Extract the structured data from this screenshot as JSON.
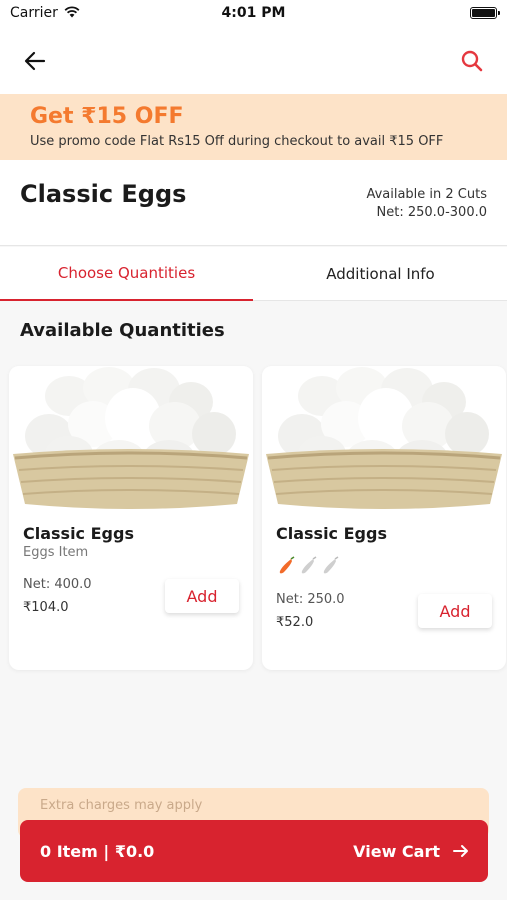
{
  "status_bar": {
    "carrier": "Carrier",
    "time": "4:01 PM"
  },
  "nav": {
    "back_icon": "arrow-left-icon",
    "search_icon": "search-icon"
  },
  "promo": {
    "title": "Get ₹15 OFF",
    "subtitle": "Use promo code Flat Rs15 Off  during checkout to avail ₹15 OFF"
  },
  "product": {
    "name": "Classic Eggs",
    "cuts": "Available in 2 Cuts",
    "net": "Net: 250.0-300.0"
  },
  "tabs": [
    {
      "label": "Choose Quantities",
      "active": true
    },
    {
      "label": "Additional Info",
      "active": false
    }
  ],
  "section_title": "Available Quantities",
  "cards": [
    {
      "name": "Classic Eggs",
      "type": "Eggs Item",
      "net": "Net: 400.0",
      "price": "₹104.0",
      "add_label": "Add"
    },
    {
      "name": "Classic Eggs",
      "spice_level": 1,
      "spice_max": 3,
      "net": "Net: 250.0",
      "price": "₹52.0",
      "add_label": "Add"
    }
  ],
  "extra_charges": "Extra charges may apply",
  "cart": {
    "summary": "0 Item | ₹0.0",
    "view_label": "View Cart"
  },
  "colors": {
    "accent": "#d8232f",
    "promo_bg": "#fde3c8",
    "promo_title": "#f47a2f"
  }
}
